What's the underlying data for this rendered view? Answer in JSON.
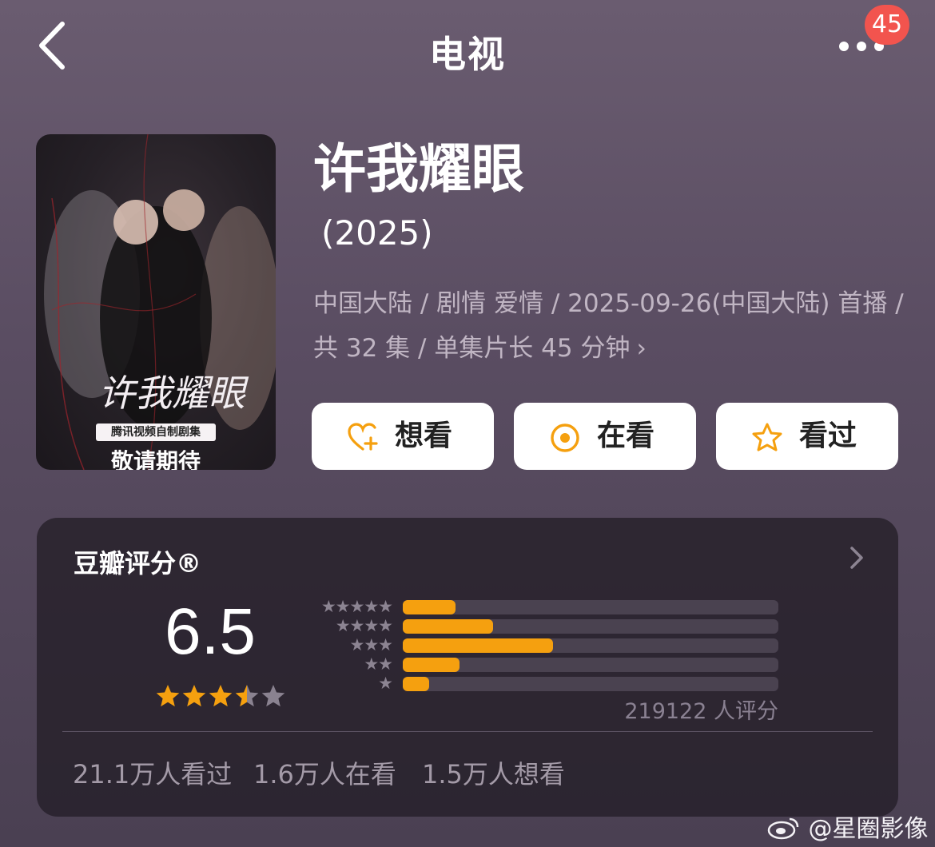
{
  "nav": {
    "title": "电视",
    "badge_count": "45"
  },
  "poster": {
    "title_art": "许我耀眼",
    "tag": "腾讯视频自制剧集",
    "slogan": "敬请期待"
  },
  "movie": {
    "title": "许我耀眼",
    "year": "(2025)",
    "meta": "中国大陆 / 剧情 爱情 / 2025-09-26(中国大陆) 首播 / 共 32 集 / 单集片长 45 分钟",
    "meta_chevron": "›"
  },
  "actions": [
    {
      "label": "想看",
      "icon": "heart-plus-icon"
    },
    {
      "label": "在看",
      "icon": "target-circle-icon"
    },
    {
      "label": "看过",
      "icon": "star-outline-icon"
    }
  ],
  "rating": {
    "section_title": "豆瓣评分®",
    "score": "6.5",
    "stars_value": 3.5,
    "stars_max": 5,
    "star_rows": [
      {
        "stars": "★★★★★",
        "fraction": 0.14
      },
      {
        "stars": "★★★★",
        "fraction": 0.24
      },
      {
        "stars": "★★★",
        "fraction": 0.4
      },
      {
        "stars": "★★",
        "fraction": 0.15
      },
      {
        "stars": "★",
        "fraction": 0.07
      }
    ],
    "raters": "219122 人评分"
  },
  "stats": {
    "watched": "21.1万人看过",
    "watching": "1.6万人在看",
    "want": "1.5万人想看"
  },
  "watermark": "@星圈影像",
  "colors": {
    "accent": "#f5a00f",
    "badge": "#f2544e",
    "background": "#5a4d62",
    "panel": "#26202a"
  }
}
